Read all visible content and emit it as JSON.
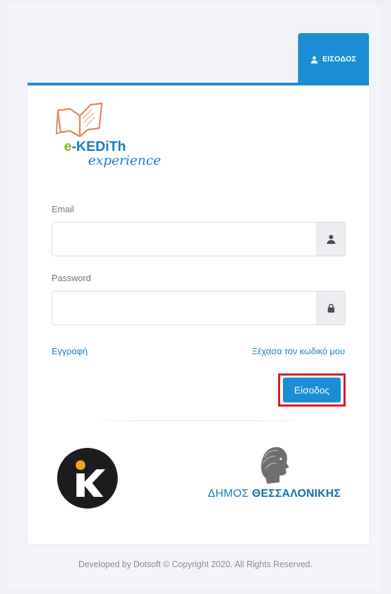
{
  "tab": {
    "label": "ΕΙΣΟΔΟΣ",
    "icon": "user-icon"
  },
  "logo": {
    "brand_prefix": "e",
    "brand_main": "-KEDiTh",
    "brand_sub": "experience"
  },
  "form": {
    "email": {
      "label": "Email",
      "value": "",
      "placeholder": "",
      "icon": "user-icon"
    },
    "password": {
      "label": "Password",
      "value": "",
      "placeholder": "",
      "icon": "lock-icon"
    },
    "register_link": "Εγγραφή",
    "forgot_link": "Ξέχασα τον κωδικό μου",
    "submit_label": "Είσοδος"
  },
  "partners": {
    "dimos_prefix": "ΔΗΜΟΣ ",
    "dimos_name": "ΘΕΣΣΑΛΟΝΙΚΗΣ"
  },
  "footer": {
    "text": "Developed by Dotsoft © Copyright 2020. All Rights Reserved."
  },
  "colors": {
    "accent": "#1b8ed3",
    "highlight": "#e3141d",
    "link": "#1a80bf"
  }
}
